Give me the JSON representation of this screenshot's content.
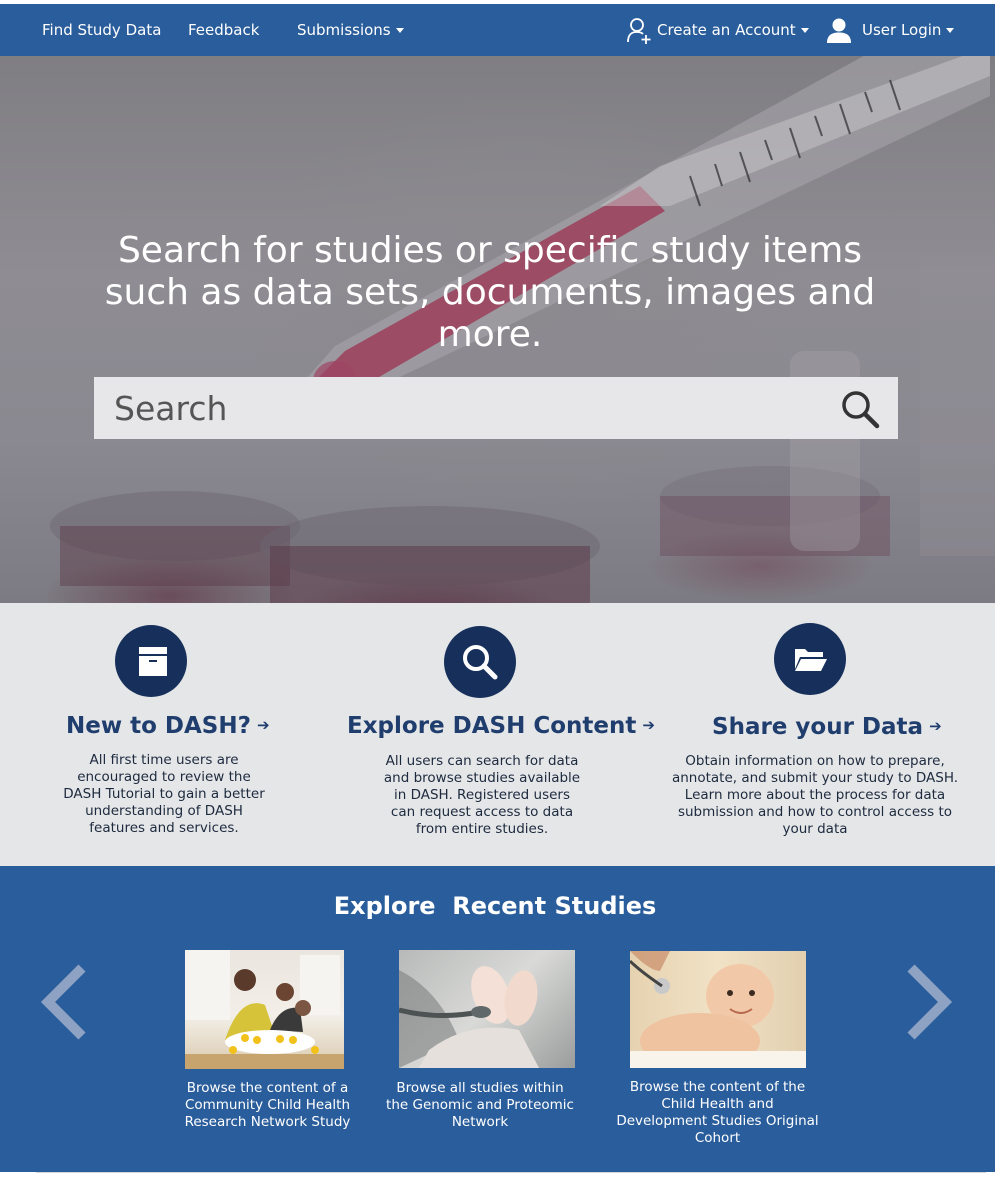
{
  "nav": {
    "find_study_data": "Find Study Data",
    "feedback": "Feedback",
    "submissions": "Submissions",
    "create_account": "Create an Account",
    "user_login": "User Login"
  },
  "hero": {
    "title": "Search for studies or specific study items such as data sets, documents, images and more.",
    "search_placeholder": "Search"
  },
  "features": [
    {
      "title": "New to DASH?",
      "text": "All first time users are encouraged to review the DASH Tutorial to gain a better understanding of DASH features and services."
    },
    {
      "title": "Explore DASH Content",
      "text": "All users can search for data and browse studies available in DASH. Registered users can request access to data from entire studies."
    },
    {
      "title": "Share your Data",
      "text": "Obtain information on how to prepare, annotate, and submit your study to DASH. Learn more about the process for data submission and how to control access to your data"
    }
  ],
  "recent": {
    "title": "Explore  Recent Studies",
    "studies": [
      {
        "caption": "Browse the content of a Community Child Health Research Network Study"
      },
      {
        "caption": "Browse all studies within the Genomic and Proteomic Network"
      },
      {
        "caption": "Browse the content of the Child Health and Development Studies Original Cohort"
      }
    ]
  },
  "colors": {
    "nav_blue": "#2a5d9b",
    "feature_circle": "#17305b",
    "feature_title": "#1f3d6d",
    "feature_bg": "#e5e6e8"
  }
}
